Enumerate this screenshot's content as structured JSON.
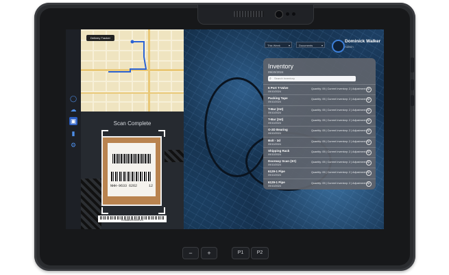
{
  "sidebar": {
    "icons": [
      "circle-icon",
      "cloud-icon",
      "box-icon",
      "bar-chart-icon",
      "gear-icon"
    ]
  },
  "map": {
    "chip_label": "Delivery Tracker"
  },
  "scan": {
    "title": "Scan Complete",
    "label_number": "NHH-9633 6262",
    "label_suffix": "12",
    "bottom_barcode_text": "0136AB1001009123"
  },
  "header": {
    "filter1": "This Week",
    "filter2": "Documents",
    "user_name": "Dominick Walker",
    "user_role": "Admin"
  },
  "inventory": {
    "title": "Inventory",
    "date": "09/20/2024",
    "search_placeholder": "Search inventory",
    "items": [
      {
        "name": "6 Port T-Valve",
        "date": "09/10/2024",
        "meta": "Quantity: 05 | Current Inventory: 2 | Adjustment: 00"
      },
      {
        "name": "Packing Tape",
        "date": "09/10/2024",
        "meta": "Quantity: 05 | Current Inventory: 2 | Adjustment: 00"
      },
      {
        "name": "T-Bar (2st)",
        "date": "09/10/2024",
        "meta": "Quantity: 05 | Current Inventory: 2 | Adjustment: 00"
      },
      {
        "name": "T-Bar (3st)",
        "date": "09/10/2024",
        "meta": "Quantity: 05 | Current Inventory: 2 | Adjustment: 00"
      },
      {
        "name": "O-2D Bearing",
        "date": "09/10/2024",
        "meta": "Quantity: 05 | Current Inventory: 2 | Adjustment: 00"
      },
      {
        "name": "Bolt - 3d",
        "date": "09/10/2024",
        "meta": "Quantity: 05 | Current Inventory: 2 | Adjustment: 00"
      },
      {
        "name": "Shipping Rack",
        "date": "09/10/2024",
        "meta": "Quantity: 05 | Current Inventory: 2 | Adjustment: 00"
      },
      {
        "name": "Doorway Scan (3rt)",
        "date": "09/10/2024",
        "meta": "Quantity: 05 | Current Inventory: 2 | Adjustment: 00"
      },
      {
        "name": "6129-1 Pipe",
        "date": "09/10/2024",
        "meta": "Quantity: 05 | Current Inventory: 2 | Adjustment: 00"
      },
      {
        "name": "6129-1 Pipe",
        "date": "09/10/2024",
        "meta": "Quantity: 05 | Current Inventory: 2 | Adjustment: 00"
      }
    ]
  },
  "hardware": {
    "minus": "−",
    "plus": "+",
    "p1": "P1",
    "p2": "P2"
  }
}
